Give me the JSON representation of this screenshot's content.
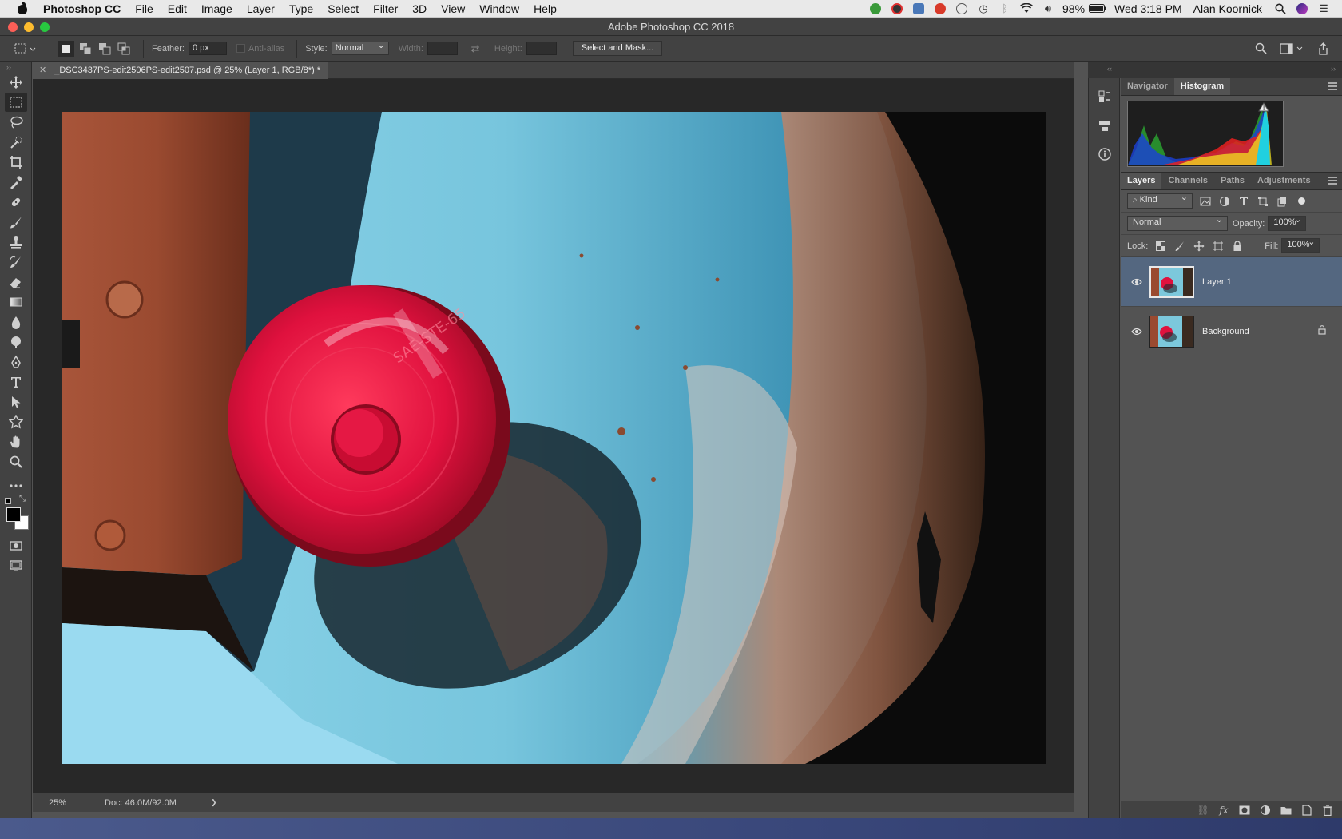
{
  "menubar": {
    "app_name": "Photoshop CC",
    "menus": [
      "File",
      "Edit",
      "Image",
      "Layer",
      "Type",
      "Select",
      "Filter",
      "3D",
      "View",
      "Window",
      "Help"
    ],
    "battery": "98%",
    "clock": "Wed 3:18 PM",
    "user": "Alan Koornick"
  },
  "window": {
    "title": "Adobe Photoshop CC 2018"
  },
  "options": {
    "feather_label": "Feather:",
    "feather_value": "0 px",
    "antialias_label": "Anti-alias",
    "style_label": "Style:",
    "style_value": "Normal",
    "width_label": "Width:",
    "height_label": "Height:",
    "select_mask_label": "Select and Mask..."
  },
  "document": {
    "tab_title": "_DSC3437PS-edit2506PS-edit2507.psd @ 25% (Layer 1, RGB/8*) *",
    "zoom": "25%",
    "doc_size": "Doc: 46.0M/92.0M",
    "status_arrow": "❯"
  },
  "panels": {
    "top_tabs": [
      "Navigator",
      "Histogram"
    ],
    "layer_tabs": [
      "Layers",
      "Channels",
      "Paths",
      "Adjustments"
    ],
    "kind_label": "Kind",
    "blend_mode": "Normal",
    "opacity_label": "Opacity:",
    "opacity_value": "100%",
    "lock_label": "Lock:",
    "fill_label": "Fill:",
    "fill_value": "100%",
    "layers": [
      {
        "name": "Layer 1",
        "selected": true
      },
      {
        "name": "Background",
        "selected": false
      }
    ]
  },
  "colors": {
    "accent_selection": "#546780",
    "panel_bg": "#535353",
    "chrome_bg": "#424242"
  }
}
